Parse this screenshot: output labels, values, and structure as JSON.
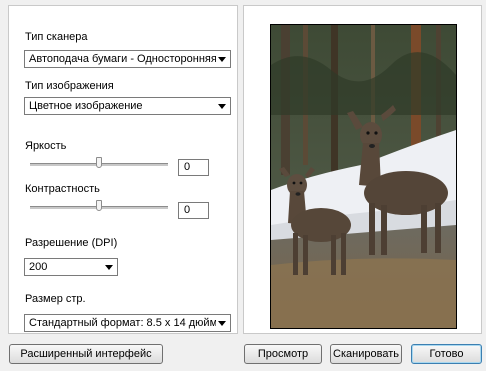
{
  "scanner_type": {
    "label": "Тип сканера",
    "value": "Автоподача бумаги - Односторонняя"
  },
  "image_type": {
    "label": "Тип изображения",
    "value": "Цветное изображение"
  },
  "brightness": {
    "label": "Яркость",
    "value": "0",
    "level": 0.5
  },
  "contrast": {
    "label": "Контрастность",
    "value": "0",
    "level": 0.5
  },
  "resolution": {
    "label": "Разрешение (DPI)",
    "value": "200"
  },
  "page_size": {
    "label": "Размер стр.",
    "value": "Стандартный формат: 8.5 x 14 дюйм"
  },
  "buttons": {
    "advanced": "Расширенный интерфейс",
    "preview": "Просмотр",
    "scan": "Сканировать",
    "done": "Готово"
  },
  "preview_image": {
    "subject": "two deer standing on snowy ground in a forest"
  },
  "colors": {
    "focus_border": "#3c7fb1",
    "panel_bg": "#ffffff",
    "window_bg": "#f0f0f0"
  }
}
